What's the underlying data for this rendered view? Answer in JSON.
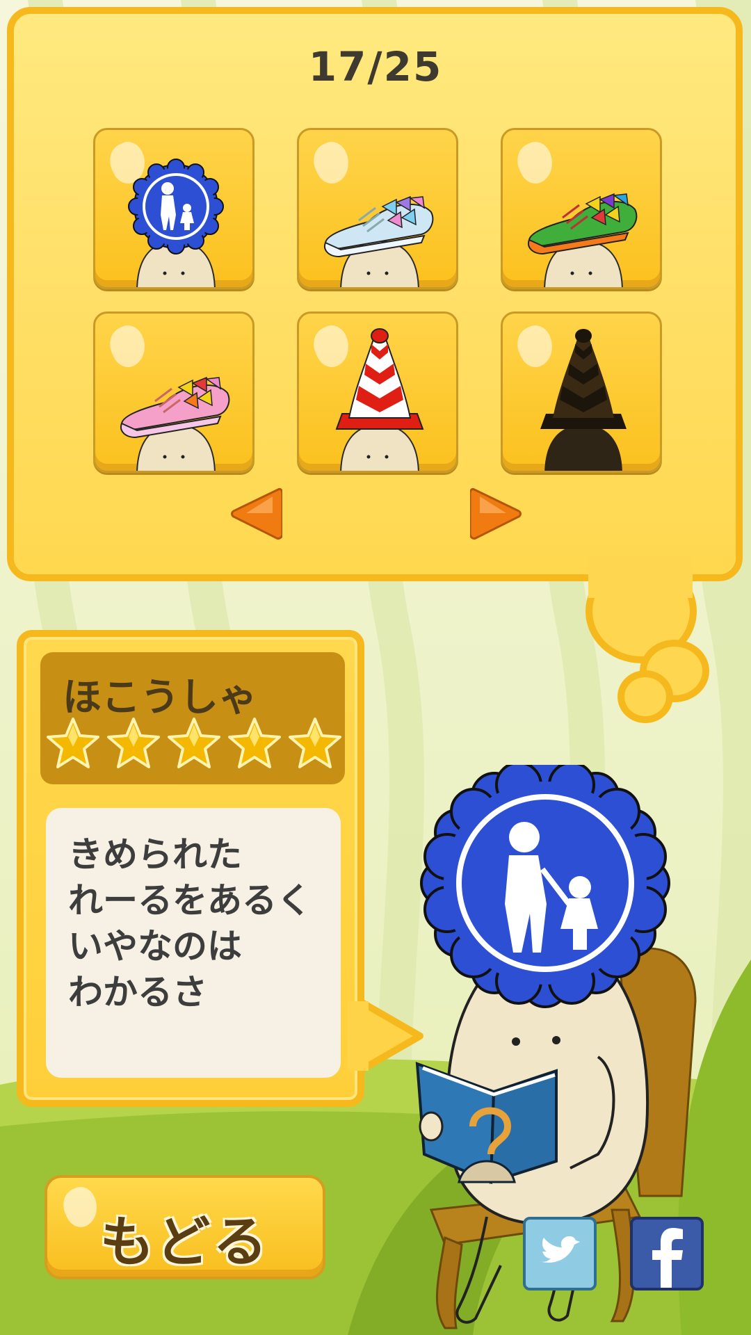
{
  "progress": {
    "counter": "17/25"
  },
  "hats": [
    {
      "label": "ほこうしゃ",
      "icon": "pedestrian-sign-hat-icon"
    },
    {
      "label": "",
      "icon": "white-sneaker-hat-icon"
    },
    {
      "label": "",
      "icon": "orange-sneaker-hat-icon"
    },
    {
      "label": "",
      "icon": "pink-sneaker-hat-icon"
    },
    {
      "label": "",
      "icon": "traffic-cone-hat-icon"
    },
    {
      "label": "",
      "icon": "locked-silhouette-cone-icon"
    }
  ],
  "nav": {
    "prev_icon": "arrow-left-icon",
    "next_icon": "arrow-right-icon"
  },
  "detail": {
    "name": "ほこうしゃ",
    "rating": 5,
    "rating_max": 5,
    "description_lines": [
      "きめられた",
      "れーるをあるく",
      "いやなのは",
      "わかるさ"
    ]
  },
  "buttons": {
    "back_label": "もどる"
  },
  "social": {
    "twitter_icon": "twitter-icon",
    "facebook_icon": "facebook-icon"
  },
  "colors": {
    "panel": "#ffd95a",
    "panel_border": "#f6b91d",
    "tile": "#fbc11e",
    "star": "#f4b800",
    "sign_blue": "#2d4fd4"
  }
}
